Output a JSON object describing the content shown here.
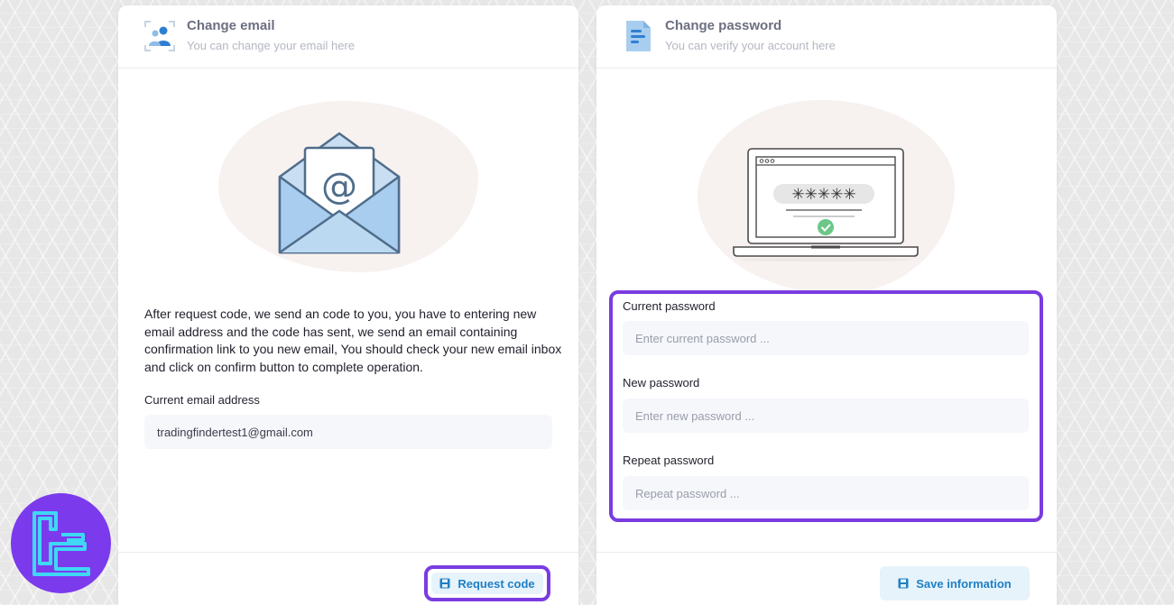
{
  "email_card": {
    "title": "Change email",
    "subtitle": "You can change your email here",
    "icon": "user-focus-icon",
    "illustration": "envelope-at-icon",
    "description": "After request code, we send an code to you, you have to entering new email address and the code has sent, we send an email containing confirmation link to you new email, You should check your new email inbox and click on confirm button to complete operation.",
    "current_email_label": "Current email address",
    "current_email_value": "tradingfindertest1@gmail.com",
    "request_button": "Request code"
  },
  "password_card": {
    "title": "Change password",
    "subtitle": "You can verify your account here",
    "icon": "document-icon",
    "illustration": "laptop-password-icon",
    "illustration_mask": "✳✳✳✳✳",
    "current_label": "Current password",
    "current_placeholder": "Enter current password ...",
    "new_label": "New password",
    "new_placeholder": "Enter new password ...",
    "repeat_label": "Repeat password",
    "repeat_placeholder": "Repeat password ...",
    "save_button": "Save information"
  },
  "colors": {
    "highlight": "#7a3ce0",
    "button_bg": "#e6f3fb",
    "button_text": "#1e7fc4",
    "logo_bg": "#7c3aed",
    "logo_fg": "#3fd8f5"
  },
  "logo": {
    "icon": "tradingfinder-logo-icon"
  }
}
